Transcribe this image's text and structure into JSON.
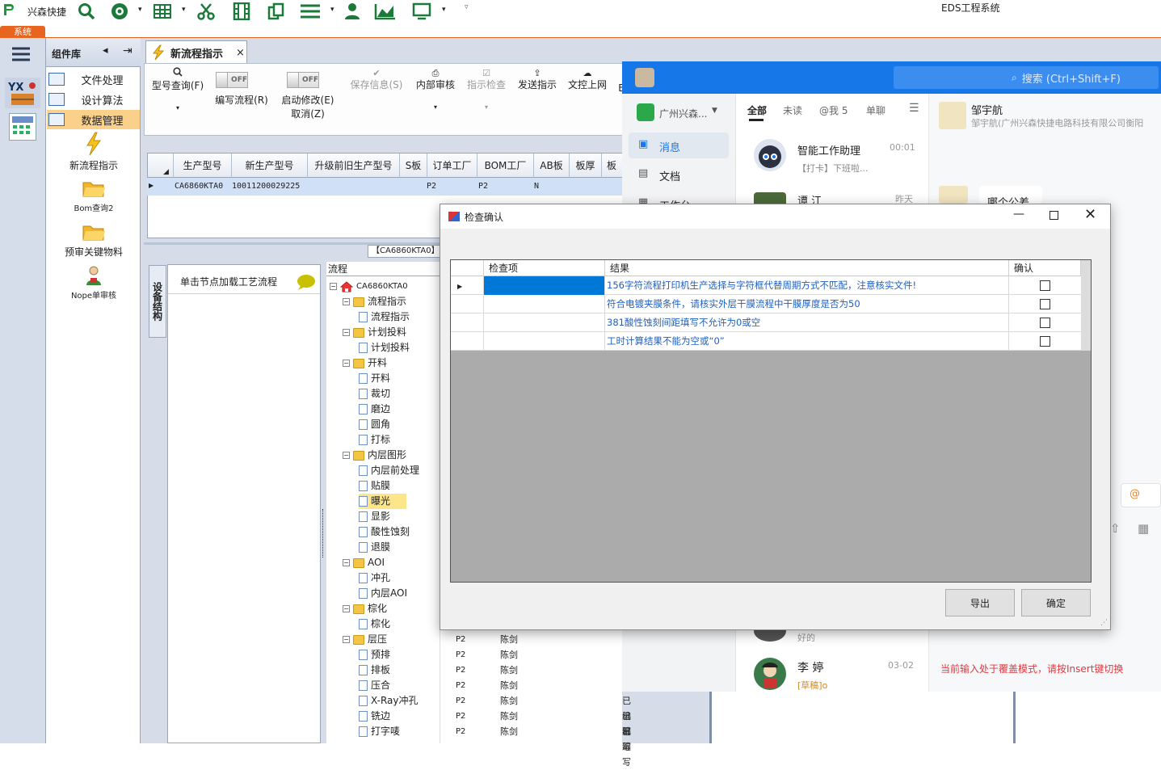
{
  "app": {
    "brand": "兴森快捷",
    "window_title": "EDS工程系统",
    "system_tab": "系统"
  },
  "toolbar_icons": [
    "search-icon",
    "globe-icon",
    "grid-icon",
    "scissors-icon",
    "film-icon",
    "copy-icon",
    "list-icon",
    "user-icon",
    "chart-icon",
    "monitor-icon"
  ],
  "component_panel": {
    "title": "组件库",
    "rows": [
      "文件处理",
      "设计算法",
      "数据管理"
    ],
    "items": [
      "新流程指示",
      "Bom查询2",
      "预审关键物料",
      "Nope单审核"
    ]
  },
  "doc_tab": {
    "label": "新流程指示",
    "close": "×"
  },
  "ribbon": {
    "model_query": "型号查询(F)",
    "toggle_off": "OFF",
    "edit_flow": "编写流程(R)",
    "start_modify": "启动修改(E)",
    "cancel": "取消(Z)",
    "save_info": "保存信息(S)",
    "internal_review": "内部审核",
    "instruction_check": "指示检查",
    "send_instruction": "发送指示",
    "upload": "文控上网",
    "more": "E"
  },
  "grid1": {
    "headers": [
      "生产型号",
      "新生产型号",
      "升级前旧生产型号",
      "S板",
      "订单工厂",
      "BOM工厂",
      "AB板",
      "板厚",
      "板"
    ],
    "row": [
      "CA6860KTA0",
      "10011200029225",
      "",
      "",
      "P2",
      "P2",
      "N",
      "",
      ""
    ]
  },
  "tree": {
    "tag_label": "【CA6860KTA0】",
    "side_tab": "设备结构",
    "hint": "单击节点加载工艺流程",
    "header": "流程",
    "root": "CA6860KTA0",
    "nodes": [
      {
        "label": "流程指示",
        "type": "folder"
      },
      {
        "label": "流程指示",
        "type": "file"
      },
      {
        "label": "计划投料",
        "type": "folder"
      },
      {
        "label": "计划投料",
        "type": "file"
      },
      {
        "label": "开料",
        "type": "folder"
      },
      {
        "label": "开料",
        "type": "file"
      },
      {
        "label": "裁切",
        "type": "file"
      },
      {
        "label": "磨边",
        "type": "file"
      },
      {
        "label": "圆角",
        "type": "file"
      },
      {
        "label": "打标",
        "type": "file"
      },
      {
        "label": "内层图形",
        "type": "folder"
      },
      {
        "label": "内层前处理",
        "type": "file"
      },
      {
        "label": "贴膜",
        "type": "file"
      },
      {
        "label": "曝光",
        "type": "file"
      },
      {
        "label": "显影",
        "type": "file"
      },
      {
        "label": "酸性蚀刻",
        "type": "file"
      },
      {
        "label": "退膜",
        "type": "file"
      },
      {
        "label": "AOI",
        "type": "folder"
      },
      {
        "label": "冲孔",
        "type": "file"
      },
      {
        "label": "内层AOI",
        "type": "file"
      },
      {
        "label": "棕化",
        "type": "folder"
      },
      {
        "label": "棕化",
        "type": "file"
      },
      {
        "label": "层压",
        "type": "folder"
      },
      {
        "label": "预排",
        "type": "file"
      },
      {
        "label": "排板",
        "type": "file"
      },
      {
        "label": "压合",
        "type": "file"
      },
      {
        "label": "X-Ray冲孔",
        "type": "file"
      },
      {
        "label": "铣边",
        "type": "file"
      },
      {
        "label": "打字唛",
        "type": "file"
      }
    ],
    "extra_cols": {
      "factory": "P2",
      "person": "陈剑",
      "status": "已编写"
    }
  },
  "chat": {
    "search_placeholder": "搜索 (Ctrl+Shift+F)",
    "org": "广州兴森...",
    "nav": [
      "消息",
      "文档",
      "工作台"
    ],
    "filters": [
      "全部",
      "未读",
      "@我 5",
      "单聊"
    ],
    "items": [
      {
        "name": "智能工作助理",
        "preview": "【打卡】下班啦...",
        "time": "00:01"
      },
      {
        "name": "谭 江",
        "preview": "",
        "time": "昨天"
      },
      {
        "name": "",
        "preview": "好的",
        "time": ""
      },
      {
        "name": "李 婷",
        "preview": "[草稿]o",
        "time": "03-02"
      }
    ],
    "contact_name": "邹宇航",
    "contact_sub": "邹宇航(广州兴森快捷电路科技有限公司衡阳",
    "bubble": "哪个公差",
    "insert_hint": "当前输入处于覆盖模式，请按Insert键切换",
    "at_label": "@"
  },
  "dialog": {
    "title": "检查确认",
    "headers": [
      "检查项",
      "结果",
      "确认"
    ],
    "rows": [
      {
        "item": "",
        "result": "156字符流程打印机生产选择与字符框代替周期方式不匹配，注意核实文件!",
        "checked": false
      },
      {
        "item": "",
        "result": "符合电镀夹膜条件，请核实外层干膜流程中干膜厚度是否为50",
        "checked": false
      },
      {
        "item": "",
        "result": "381酸性蚀刻间距填写不允许为0或空",
        "checked": false
      },
      {
        "item": "",
        "result": "工时计算结果不能为空或“0”",
        "checked": false
      }
    ],
    "export_btn": "导出",
    "ok_btn": "确定"
  }
}
